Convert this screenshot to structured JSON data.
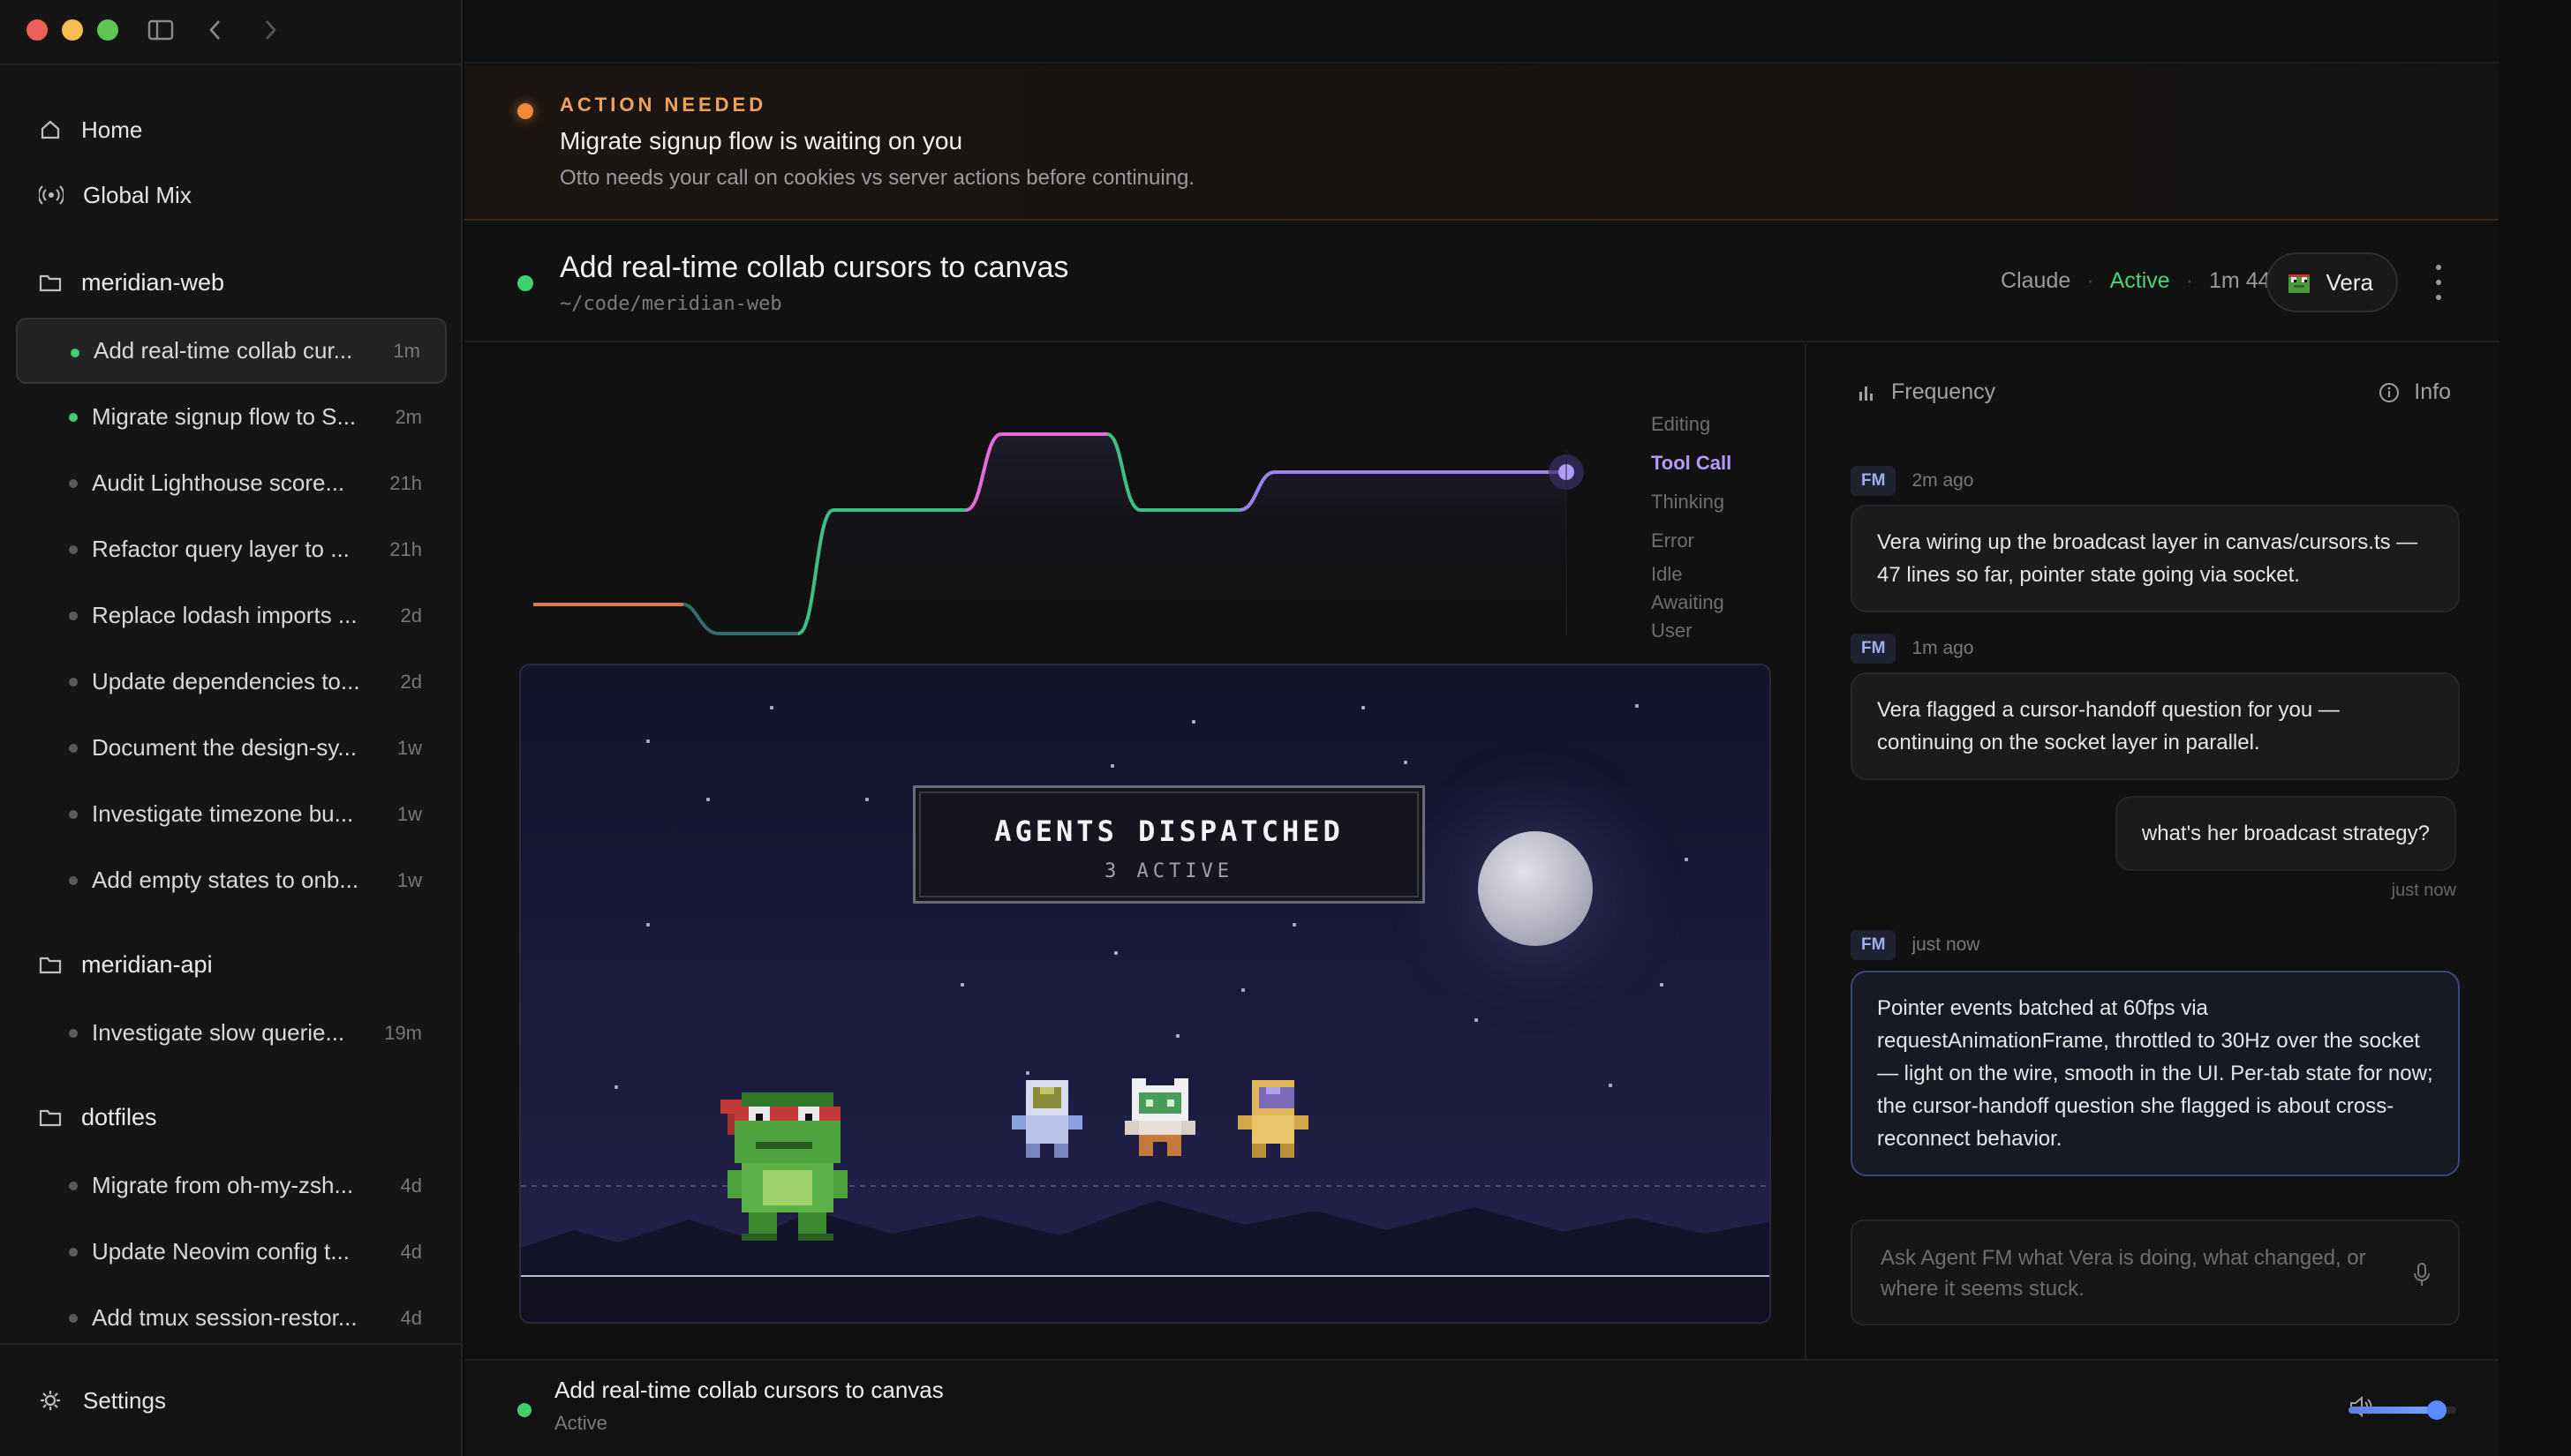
{
  "sidebar": {
    "nav": [
      {
        "label": "Home",
        "icon": "home-icon"
      },
      {
        "label": "Global Mix",
        "icon": "broadcast-icon"
      }
    ],
    "groups": [
      {
        "name": "meridian-web",
        "sessions": [
          {
            "label": "Add real-time collab cur...",
            "age": "1m",
            "status": "live",
            "active": true
          },
          {
            "label": "Migrate signup flow to S...",
            "age": "2m",
            "status": "live"
          },
          {
            "label": "Audit Lighthouse score...",
            "age": "21h",
            "status": "idle"
          },
          {
            "label": "Refactor query layer to ...",
            "age": "21h",
            "status": "idle"
          },
          {
            "label": "Replace lodash imports ...",
            "age": "2d",
            "status": "idle"
          },
          {
            "label": "Update dependencies to...",
            "age": "2d",
            "status": "idle"
          },
          {
            "label": "Document the design-sy...",
            "age": "1w",
            "status": "idle"
          },
          {
            "label": "Investigate timezone bu...",
            "age": "1w",
            "status": "idle"
          },
          {
            "label": "Add empty states to onb...",
            "age": "1w",
            "status": "idle"
          }
        ]
      },
      {
        "name": "meridian-api",
        "sessions": [
          {
            "label": "Investigate slow querie...",
            "age": "19m",
            "status": "idle"
          }
        ]
      },
      {
        "name": "dotfiles",
        "sessions": [
          {
            "label": "Migrate from oh-my-zsh...",
            "age": "4d",
            "status": "idle"
          },
          {
            "label": "Update Neovim config t...",
            "age": "4d",
            "status": "idle"
          },
          {
            "label": "Add tmux session-restor...",
            "age": "4d",
            "status": "idle"
          }
        ]
      }
    ],
    "settings_label": "Settings"
  },
  "banner": {
    "kicker": "ACTION NEEDED",
    "title": "Migrate signup flow is waiting on you",
    "subtitle": "Otto needs your call on cookies vs server actions before continuing.",
    "accent": "#f08a3a"
  },
  "header": {
    "title": "Add real-time collab cursors to canvas",
    "path": "~/code/meridian-web",
    "model": "Claude",
    "sep": "·",
    "status": "Active",
    "elapsed": "1m 44s",
    "agent": "Vera"
  },
  "activity": {
    "states": [
      "Editing",
      "Tool Call",
      "Thinking",
      "Error",
      "Idle",
      "Awaiting",
      "User"
    ],
    "current_state": "Tool Call"
  },
  "scene": {
    "title": "AGENTS DISPATCHED",
    "subtitle": "3 ACTIVE"
  },
  "panel": {
    "title": "Frequency",
    "info_label": "Info",
    "messages": [
      {
        "from": "FM",
        "time": "2m ago",
        "text": "Vera wiring up the broadcast layer in canvas/cursors.ts — 47 lines so far, pointer state going via socket."
      },
      {
        "from": "FM",
        "time": "1m ago",
        "text": "Vera flagged a cursor-handoff question for you — continuing on the socket layer in parallel."
      },
      {
        "from": "user",
        "time": "just now",
        "text": "what's her broadcast strategy?"
      },
      {
        "from": "FM",
        "time": "just now",
        "text": "Pointer events batched at 60fps via requestAnimationFrame, throttled to 30Hz over the socket — light on the wire, smooth in the UI. Per-tab state for now; the cursor-handoff question she flagged is about cross-reconnect behavior."
      }
    ],
    "input_placeholder": "Ask Agent FM what Vera is doing, what changed, or where it seems stuck."
  },
  "player": {
    "title": "Add real-time collab cursors to canvas",
    "status": "Active",
    "volume": 0.82
  }
}
